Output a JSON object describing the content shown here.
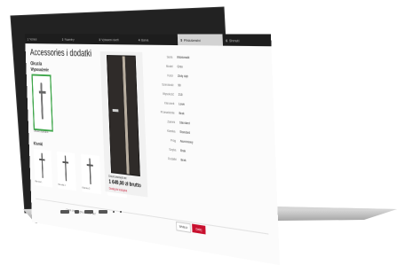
{
  "screen": {
    "steps": [
      {
        "num": "1",
        "label": "Vzhled",
        "active": false
      },
      {
        "num": "2",
        "label": "Rozměry",
        "active": false
      },
      {
        "num": "3",
        "label": "Vybavení dveří",
        "active": false
      },
      {
        "num": "4",
        "label": "Barva",
        "active": false
      },
      {
        "num": "5",
        "label": "Příslušenství",
        "active": true
      },
      {
        "num": "6",
        "label": "Shrnutí",
        "active": false
      }
    ],
    "title": "Accessories i dodatki",
    "section": "Okucia",
    "subsection": "Wyposażenie",
    "selected_caption": "Okucie standard",
    "second_section": "Klamki",
    "mini_items": [
      {
        "caption": "Klamka 1"
      },
      {
        "caption": "Klamka 2"
      },
      {
        "caption": "Klamka 3"
      },
      {
        "caption": "Klamka 4"
      }
    ],
    "preview": {
      "title": "Drzwi zewnętrzne",
      "price": "1 649,00 zł brutto",
      "link": "Dodaj do koszyka"
    },
    "specs": [
      {
        "k": "Seria",
        "v": "Wiśniowski"
      },
      {
        "k": "Model",
        "v": "Creo"
      },
      {
        "k": "Kolor",
        "v": "Złoty dąb"
      },
      {
        "k": "Szerokość",
        "v": "90"
      },
      {
        "k": "Wysokość",
        "v": "210"
      },
      {
        "k": "Kierunek",
        "v": "Lewe"
      },
      {
        "k": "Przeszklenie",
        "v": "Brak"
      },
      {
        "k": "Zamek",
        "v": "Standard"
      },
      {
        "k": "Klamka",
        "v": "Standard"
      },
      {
        "k": "Próg",
        "v": "Aluminiowy"
      },
      {
        "k": "Szyba",
        "v": "Brak"
      },
      {
        "k": "Dodatki",
        "v": "Brak"
      }
    ],
    "footer_text": "Cena orientacyjna zawiera VAT",
    "back_label": "Wstecz",
    "next_label": "Dalej"
  },
  "colors": {
    "accent": "#c8102e",
    "topbar": "#1d1d1d",
    "selected_border": "#3ea64a"
  }
}
